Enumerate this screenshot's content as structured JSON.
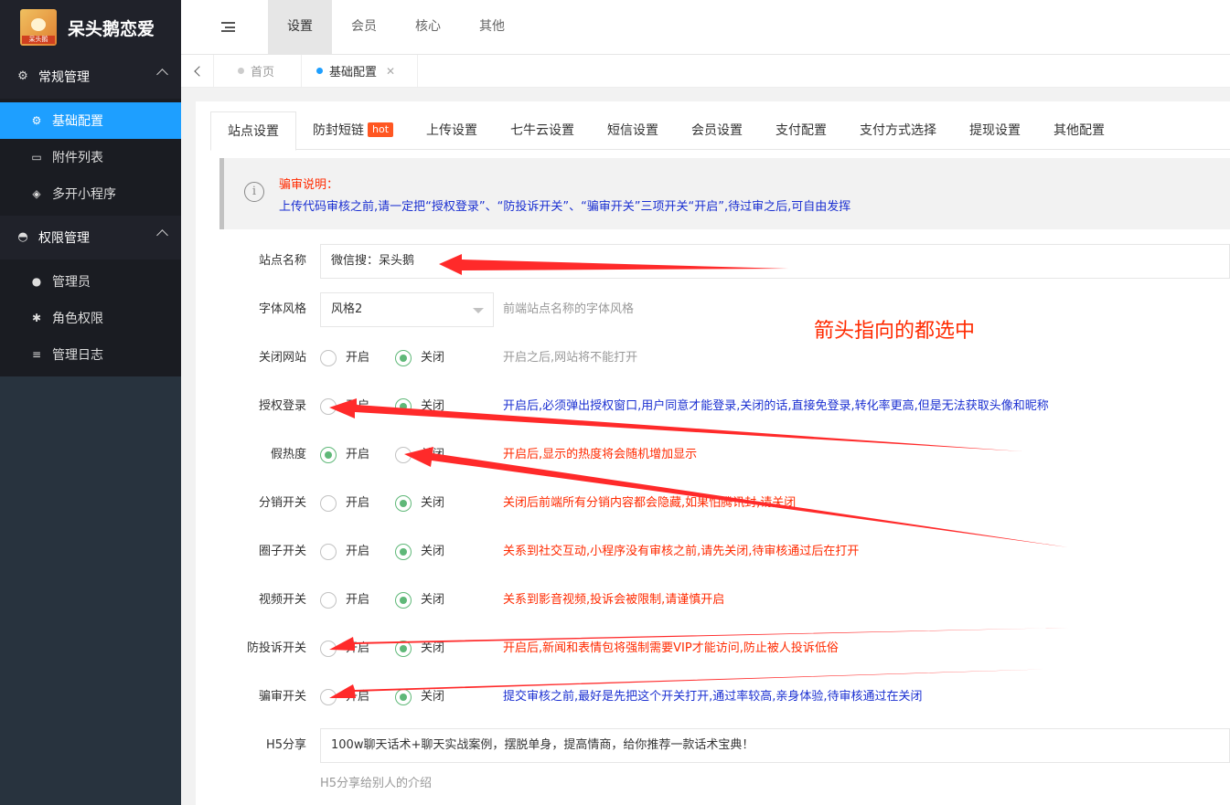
{
  "app": {
    "name": "呆头鹅恋爱",
    "logo_tag": "呆头鹅"
  },
  "sidebar": {
    "groups": [
      {
        "label": "常规管理",
        "icon": "gear-icon",
        "items": [
          {
            "label": "基础配置",
            "icon": "gear-icon",
            "active": true
          },
          {
            "label": "附件列表",
            "icon": "folder-icon",
            "active": false
          },
          {
            "label": "多开小程序",
            "icon": "cube-icon",
            "active": false
          }
        ]
      },
      {
        "label": "权限管理",
        "icon": "cat-icon",
        "items": [
          {
            "label": "管理员",
            "icon": "download-circle-icon",
            "active": false
          },
          {
            "label": "角色权限",
            "icon": "bug-icon",
            "active": false
          },
          {
            "label": "管理日志",
            "icon": "list-icon",
            "active": false
          }
        ]
      }
    ]
  },
  "topnav": {
    "items": [
      "设置",
      "会员",
      "核心",
      "其他"
    ],
    "active": "设置"
  },
  "pagetabs": {
    "home": "首页",
    "current": "基础配置"
  },
  "tabs": [
    "站点设置",
    "防封短链",
    "上传设置",
    "七牛云设置",
    "短信设置",
    "会员设置",
    "支付配置",
    "支付方式选择",
    "提现设置",
    "其他配置"
  ],
  "hot_badge": "hot",
  "notice": {
    "title": "骗审说明：",
    "text": "上传代码审核之前,请一定把“授权登录”、“防投诉开关”、“骗审开关”三项开关“开启”,待过审之后,可自由发挥"
  },
  "form": {
    "site_name": {
      "label": "站点名称",
      "value": "微信搜：呆头鹅"
    },
    "font_style": {
      "label": "字体风格",
      "value": "风格2",
      "hint": "前端站点名称的字体风格"
    },
    "radio_on_label": "开启",
    "radio_off_label": "关闭",
    "close_site": {
      "label": "关闭网站",
      "selected": "off",
      "hint": "开启之后,网站将不能打开"
    },
    "auth_login": {
      "label": "授权登录",
      "selected": "off",
      "hint": "开启后,必须弹出授权窗口,用户同意才能登录,关闭的话,直接免登录,转化率更高,但是无法获取头像和昵称"
    },
    "fake_heat": {
      "label": "假热度",
      "selected": "on",
      "hint": "开启后,显示的热度将会随机增加显示"
    },
    "distribution": {
      "label": "分销开关",
      "selected": "off",
      "hint": "关闭后前端所有分销内容都会隐藏,如果怕腾讯封,请关闭"
    },
    "circle": {
      "label": "圈子开关",
      "selected": "off",
      "hint": "关系到社交互动,小程序没有审核之前,请先关闭,待审核通过后在打开"
    },
    "video": {
      "label": "视频开关",
      "selected": "off",
      "hint": "关系到影音视频,投诉会被限制,请谨慎开启"
    },
    "anti_complaint": {
      "label": "防投诉开关",
      "selected": "off",
      "hint": "开启后,新闻和表情包将强制需要VIP才能访问,防止被人投诉低俗"
    },
    "fake_review": {
      "label": "骗审开关",
      "selected": "off",
      "hint": "提交审核之前,最好是先把这个开关打开,通过率较高,亲身体验,待审核通过在关闭"
    },
    "h5_share": {
      "label": "H5分享",
      "value": "100w聊天话术+聊天实战案例，摆脱单身，提高情商，给你推荐一款话术宝典！",
      "hint": "H5分享给别人的介绍"
    }
  },
  "annotation": "箭头指向的都选中",
  "colors": {
    "accent": "#1e9fff",
    "radio_on": "#5fb878",
    "warn_text": "#ff2a00",
    "info_text": "#1a2fd1",
    "arrow": "#ff2a2a"
  }
}
